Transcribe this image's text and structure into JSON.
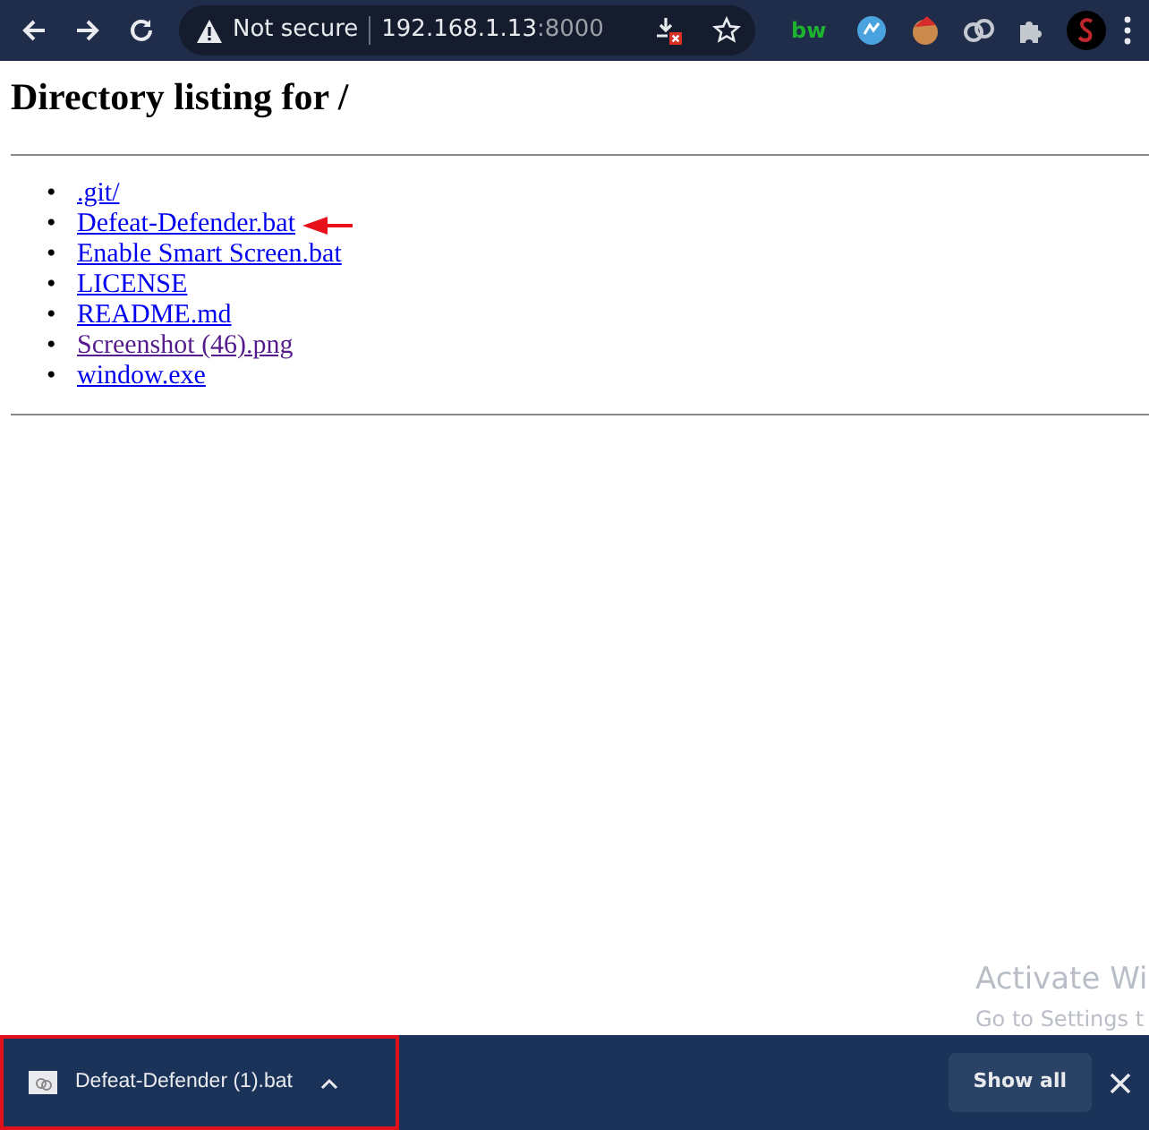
{
  "toolbar": {
    "security_label": "Not secure",
    "url_host": "192.168.1.13",
    "url_port": ":8000",
    "extension_label": "bw"
  },
  "page": {
    "heading": "Directory listing for /",
    "entries": [
      {
        "bullet": "•",
        "label": ".git/",
        "visited": false,
        "marked": false
      },
      {
        "bullet": "•",
        "label": "Defeat-Defender.bat",
        "visited": false,
        "marked": true
      },
      {
        "bullet": "•",
        "label": "Enable Smart Screen.bat",
        "visited": false,
        "marked": false
      },
      {
        "bullet": "•",
        "label": "LICENSE",
        "visited": false,
        "marked": false
      },
      {
        "bullet": "•",
        "label": "README.md",
        "visited": false,
        "marked": false
      },
      {
        "bullet": "•",
        "label": "Screenshot (46).png",
        "visited": true,
        "marked": false
      },
      {
        "bullet": "•",
        "label": "window.exe",
        "visited": false,
        "marked": false
      }
    ]
  },
  "activation_notice": {
    "title": "Activate Wi",
    "subtitle": "Go to Settings t"
  },
  "download_bar": {
    "items": [
      {
        "filename": "Defeat-Defender (1).bat",
        "highlighted": true
      }
    ],
    "show_all": "Show all"
  }
}
